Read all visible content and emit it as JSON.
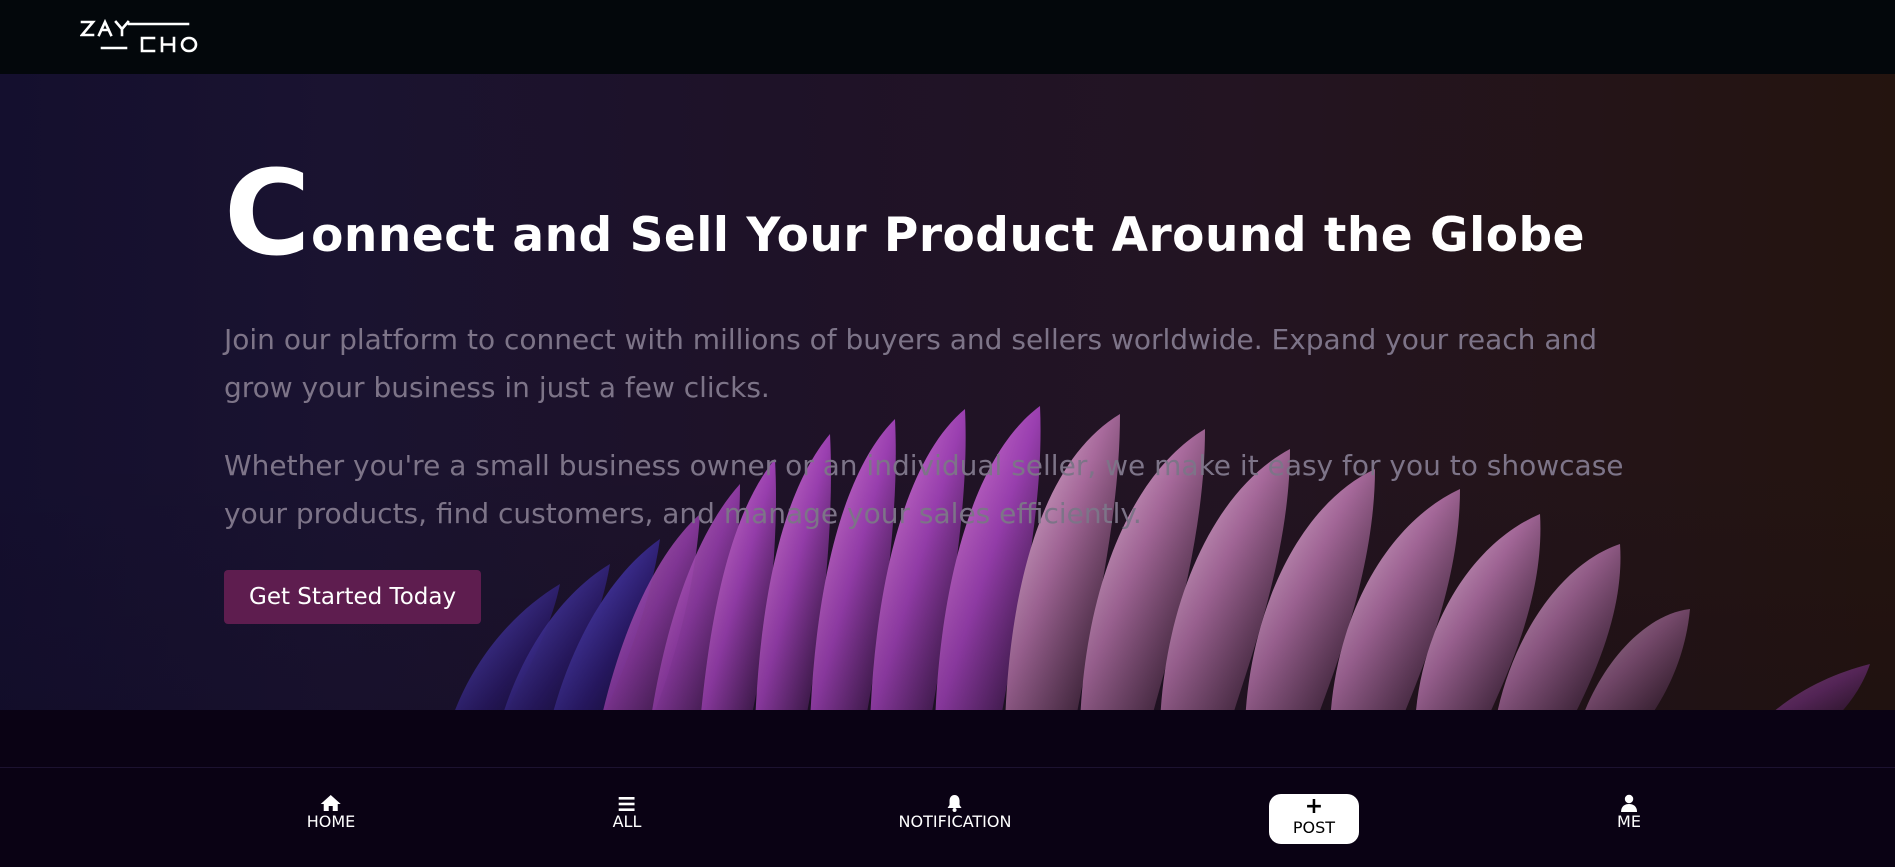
{
  "header": {
    "logo_text": "ZAYCHO",
    "logo_icon": "zaycho-logo"
  },
  "hero": {
    "headline_first_letter": "C",
    "headline_rest": "onnect and Sell Your Product Around the Globe",
    "paragraph_1": "Join our platform to connect with millions of buyers and sellers worldwide. Expand your reach and grow your business in just a few clicks.",
    "paragraph_2": "Whether you're a small business owner or an individual seller, we make it easy for you to showcase your products, find customers, and manage your sales efficiently.",
    "cta_label": "Get Started Today",
    "colors": {
      "cta_background": "#5e1d4f",
      "paragraph_text": "#7d7488",
      "headline_text": "#ffffff"
    }
  },
  "bottom_nav": {
    "items": [
      {
        "label": "HOME",
        "icon": "home-icon"
      },
      {
        "label": "ALL",
        "icon": "menu-icon"
      },
      {
        "label": "NOTIFICATION",
        "icon": "bell-icon"
      },
      {
        "label": "POST",
        "icon": "plus-icon"
      },
      {
        "label": "ME",
        "icon": "user-icon"
      }
    ]
  }
}
